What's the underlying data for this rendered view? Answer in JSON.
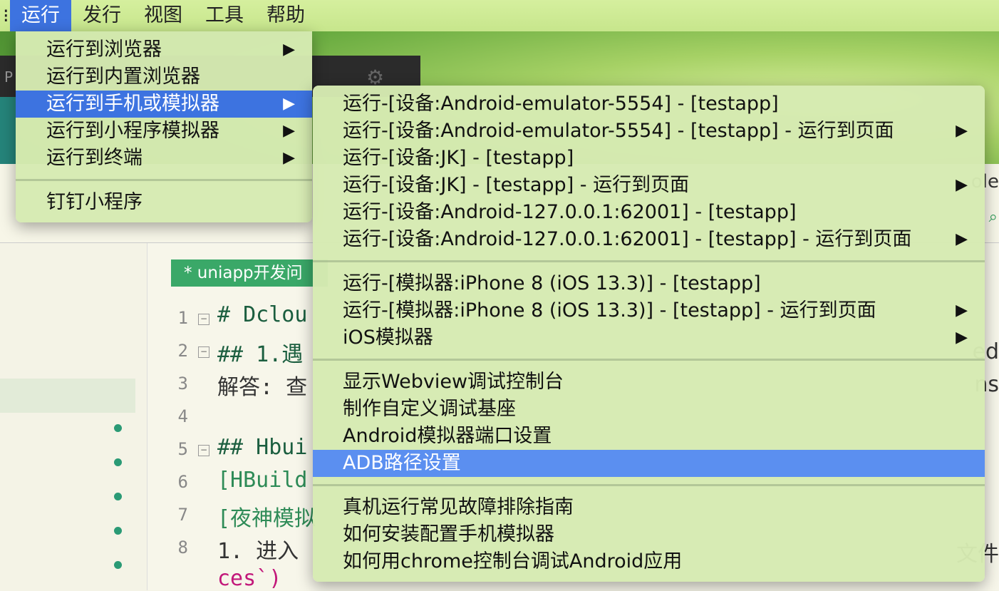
{
  "menubar": {
    "items": [
      "运行",
      "发行",
      "视图",
      "工具",
      "帮助"
    ],
    "active_index": 0
  },
  "run_menu": {
    "items": [
      {
        "label": "运行到浏览器",
        "submenu": true
      },
      {
        "label": "运行到内置浏览器",
        "submenu": false
      },
      {
        "label": "运行到手机或模拟器",
        "submenu": true,
        "highlighted": true
      },
      {
        "label": "运行到小程序模拟器",
        "submenu": true
      },
      {
        "label": "运行到终端",
        "submenu": true
      },
      {
        "label": "钉钉小程序",
        "submenu": false
      }
    ]
  },
  "device_submenu": {
    "groups": [
      [
        {
          "label": "运行-[设备:Android-emulator-5554] - [testapp]",
          "submenu": false
        },
        {
          "label": "运行-[设备:Android-emulator-5554] - [testapp] - 运行到页面",
          "submenu": true
        },
        {
          "label": "运行-[设备:JK] - [testapp]",
          "submenu": false
        },
        {
          "label": "运行-[设备:JK] - [testapp] - 运行到页面",
          "submenu": true
        },
        {
          "label": "运行-[设备:Android-127.0.0.1:62001] - [testapp]",
          "submenu": false
        },
        {
          "label": "运行-[设备:Android-127.0.0.1:62001] - [testapp] - 运行到页面",
          "submenu": true
        }
      ],
      [
        {
          "label": "运行-[模拟器:iPhone 8 (iOS 13.3)] - [testapp]",
          "submenu": false
        },
        {
          "label": "运行-[模拟器:iPhone 8 (iOS 13.3)] - [testapp] - 运行到页面",
          "submenu": true
        },
        {
          "label": "iOS模拟器",
          "submenu": true
        }
      ],
      [
        {
          "label": "显示Webview调试控制台",
          "submenu": false
        },
        {
          "label": "制作自定义调试基座",
          "submenu": false
        },
        {
          "label": "Android模拟器端口设置",
          "submenu": false
        },
        {
          "label": "ADB路径设置",
          "submenu": false,
          "highlighted": true
        }
      ],
      [
        {
          "label": "真机运行常见故障排除指南",
          "submenu": false
        },
        {
          "label": "如何安装配置手机模拟器",
          "submenu": false
        },
        {
          "label": "如何用chrome控制台调试Android应用",
          "submenu": false
        }
      ]
    ]
  },
  "editor": {
    "file_tab": "* uniapp开发问",
    "lines": [
      {
        "n": "1",
        "text": "# Dclou"
      },
      {
        "n": "2",
        "text": "## 1.遇"
      },
      {
        "n": "3",
        "text": "解答: 查"
      },
      {
        "n": "4",
        "text": ""
      },
      {
        "n": "5",
        "text": "## Hbui"
      },
      {
        "n": "6",
        "text": "[HBuild"
      },
      {
        "n": "7",
        "text": "[夜神模拟"
      },
      {
        "n": "8",
        "text": "1. 进入"
      },
      {
        "n": "",
        "text": "ces`)"
      }
    ],
    "right_edge": [
      "ole",
      "ed",
      "ns",
      "文件"
    ]
  },
  "icons": {
    "submenu_arrow": "triangle-right-icon",
    "gear": "gear-icon",
    "fold": "fold-icon",
    "search": "search-icon"
  },
  "colors": {
    "menu_bg": "#d6eab2",
    "highlight": "#3d73e0",
    "menubar_bg": "#c7e68c"
  }
}
